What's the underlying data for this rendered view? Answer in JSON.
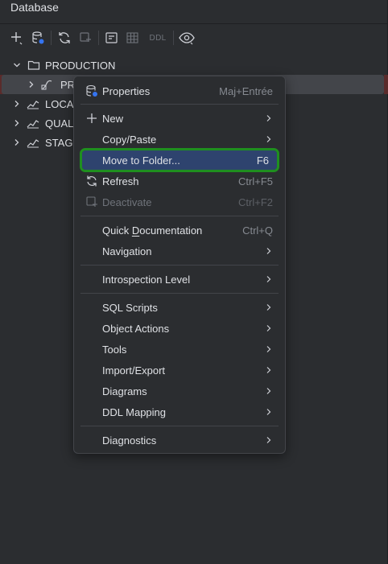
{
  "panel": {
    "title": "Database"
  },
  "toolbar": {
    "ddl_label": "DDL",
    "buttons": [
      "add-icon",
      "data-source-properties-icon",
      "refresh-icon",
      "stop-icon",
      "jump-to-console-icon",
      "table-view-icon",
      "ddl",
      "view-options-icon"
    ]
  },
  "tree": {
    "rows": [
      {
        "label": "PRODUCTION",
        "icon": "folder-icon",
        "expanded": true
      },
      {
        "label": "PR",
        "icon": "datasource-icon",
        "selected": true
      },
      {
        "label": "LOCA",
        "icon": "datasource-icon"
      },
      {
        "label": "QUAL",
        "icon": "datasource-icon"
      },
      {
        "label": "STAG",
        "icon": "datasource-icon"
      }
    ]
  },
  "menu": {
    "items": [
      {
        "label": "Properties",
        "shortcut": "Maj+Entrée",
        "icon": "properties-icon"
      },
      {
        "label": "New",
        "submenu": true,
        "icon": "plus-icon"
      },
      {
        "label": "Copy/Paste",
        "submenu": true
      },
      {
        "label": "Move to Folder...",
        "shortcut": "F6",
        "highlighted": true
      },
      {
        "label": "Refresh",
        "shortcut": "Ctrl+F5",
        "icon": "refresh-icon"
      },
      {
        "label": "Deactivate",
        "shortcut": "Ctrl+F2",
        "icon": "deactivate-icon",
        "disabled": true
      },
      {
        "label_pre": "Quick ",
        "label_mn": "D",
        "label_post": "ocumentation",
        "shortcut": "Ctrl+Q"
      },
      {
        "label": "Navigation",
        "submenu": true
      },
      {
        "label": "Introspection Level",
        "submenu": true
      },
      {
        "label": "SQL Scripts",
        "submenu": true
      },
      {
        "label": "Object Actions",
        "submenu": true
      },
      {
        "label": "Tools",
        "submenu": true
      },
      {
        "label": "Import/Export",
        "submenu": true
      },
      {
        "label": "Diagrams",
        "submenu": true
      },
      {
        "label": "DDL Mapping",
        "submenu": true
      },
      {
        "label": "Diagnostics",
        "submenu": true
      }
    ]
  },
  "colors": {
    "background": "#2b2d30",
    "highlight": "#2e436e",
    "highlight_border": "#1f8f1f",
    "selected_row": "#43454a",
    "error_stripe": "#5a2b2b"
  }
}
